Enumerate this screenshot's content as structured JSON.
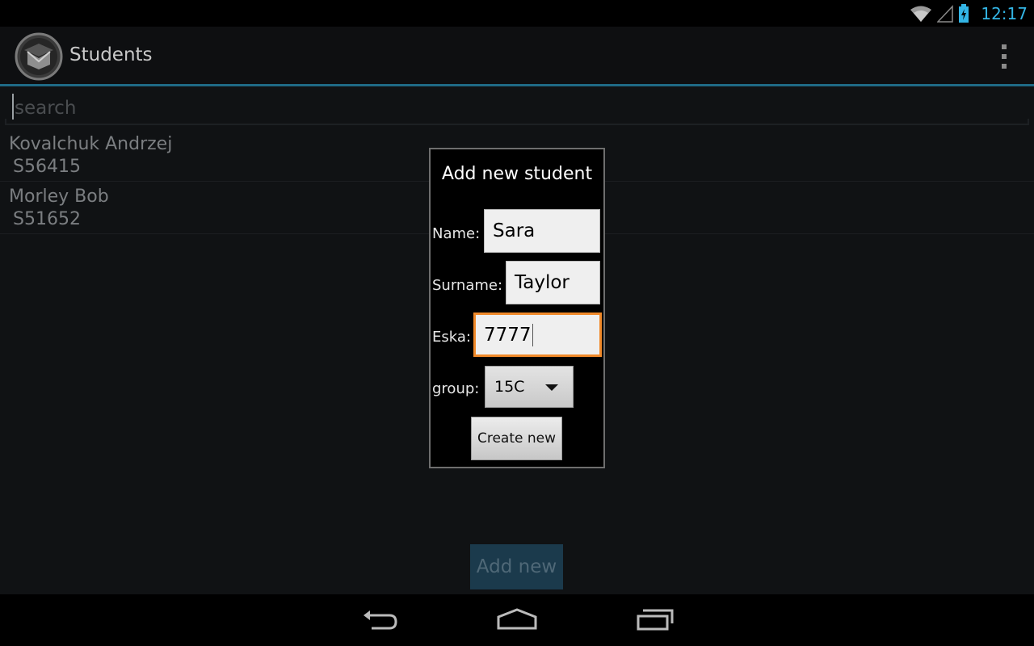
{
  "status_bar": {
    "time": "12:17",
    "icons": [
      "wifi-icon",
      "signal-icon",
      "battery-charging-icon"
    ]
  },
  "action_bar": {
    "title": "Students",
    "app_icon": "graduation-cap-icon",
    "overflow_icon": "overflow-menu-icon"
  },
  "search": {
    "placeholder": "search",
    "value": ""
  },
  "students": [
    {
      "name": "Kovalchuk Andrzej",
      "id": "S56415"
    },
    {
      "name": "Morley Bob",
      "id": "S51652"
    }
  ],
  "add_new_label": "Add new",
  "dialog": {
    "title": "Add new student",
    "name_label": "Name:",
    "name_value": "Sara",
    "surname_label": "Surname:",
    "surname_value": "Taylor",
    "eska_label": "Eska:",
    "eska_value": "7777",
    "group_label": "group:",
    "group_value": "15C",
    "create_label": "Create new"
  },
  "nav": {
    "back_icon": "back-icon",
    "home_icon": "home-icon",
    "recents_icon": "recent-apps-icon"
  },
  "colors": {
    "accent": "#33b5e5",
    "focus": "#f0892a",
    "divider": "#1f6a86"
  }
}
